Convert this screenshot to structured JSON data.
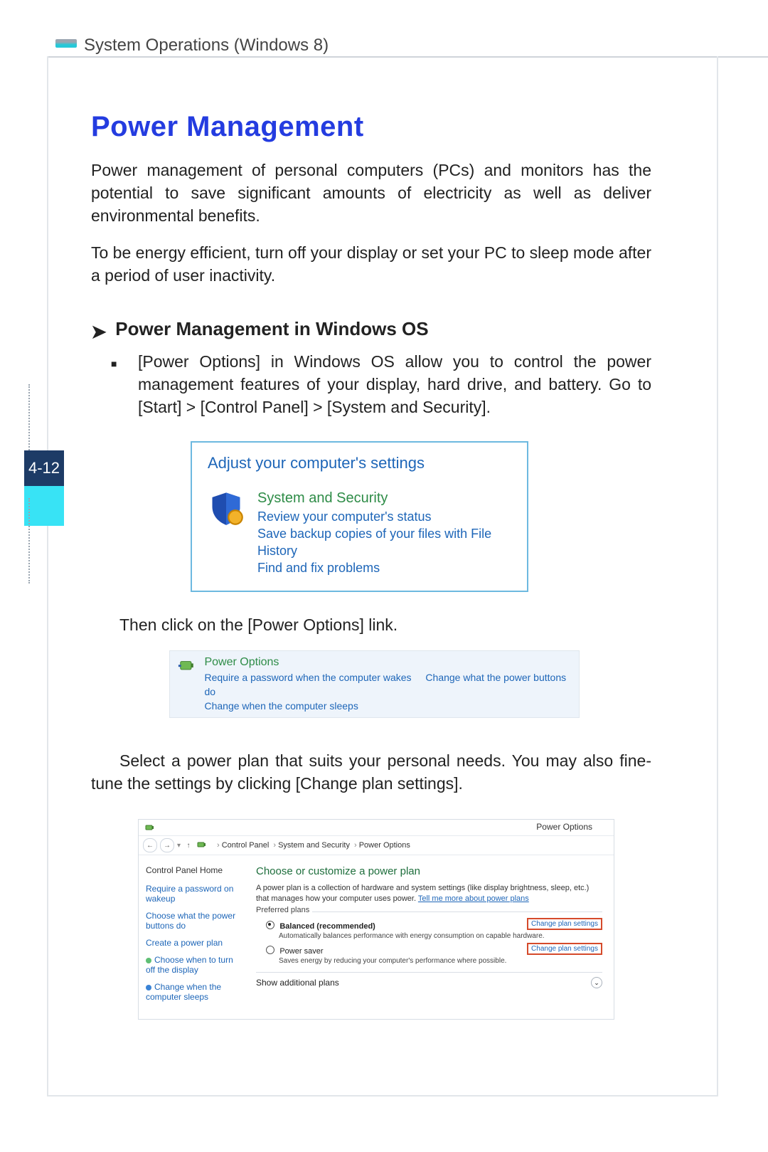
{
  "chapter": "System Operations (Windows 8)",
  "page_number": "4-12",
  "title": "Power Management",
  "intro1": "Power management of personal computers (PCs) and monitors has the potential to save significant amounts of electricity as well as deliver environmental benefits.",
  "intro2": "To be energy efficient, turn off your display or set your PC to sleep mode after a period of user inactivity.",
  "section": {
    "arrow": "➤",
    "heading": "Power Management in Windows OS"
  },
  "bullet1": "[Power Options] in Windows OS allow you to control the power management features of your display, hard drive, and battery. Go to [Start] > [Control Panel] > [System and Security].",
  "after_fig1": "Then click on the [Power Options] link.",
  "after_fig2": "Select a power plan that suits your personal needs. You may also fine-tune the settings by clicking [Change plan settings].",
  "fig1": {
    "panel_title": "Adjust your computer's settings",
    "category": "System and Security",
    "l1": "Review your computer's status",
    "l2": "Save backup copies of your files with File History",
    "l3": "Find and fix problems"
  },
  "fig2": {
    "title": "Power Options",
    "a": "Require a password when the computer wakes",
    "b": "Change what the power buttons do",
    "c": "Change when the computer sleeps"
  },
  "fig3": {
    "window_title": "Power Options",
    "crumb": {
      "root": "Control Panel",
      "b": "System and Security",
      "c": "Power Options"
    },
    "side": {
      "home": "Control Panel Home",
      "l1": "Require a password on wakeup",
      "l2": "Choose what the power buttons do",
      "l3": "Create a power plan",
      "l4": "Choose when to turn off the display",
      "l5": "Change when the computer sleeps"
    },
    "main": {
      "heading": "Choose or customize a power plan",
      "desc_a": "A power plan is a collection of hardware and system settings (like display brightness, sleep, etc.) that manages how your computer uses power. ",
      "desc_link": "Tell me more about power plans",
      "legend": "Preferred plans",
      "plan1_name": "Balanced (recommended)",
      "plan1_sub": "Automatically balances performance with energy consumption on capable hardware.",
      "plan2_name": "Power saver",
      "plan2_sub": "Saves energy by reducing your computer's performance where possible.",
      "change": "Change plan settings",
      "show_more": "Show additional plans"
    }
  }
}
